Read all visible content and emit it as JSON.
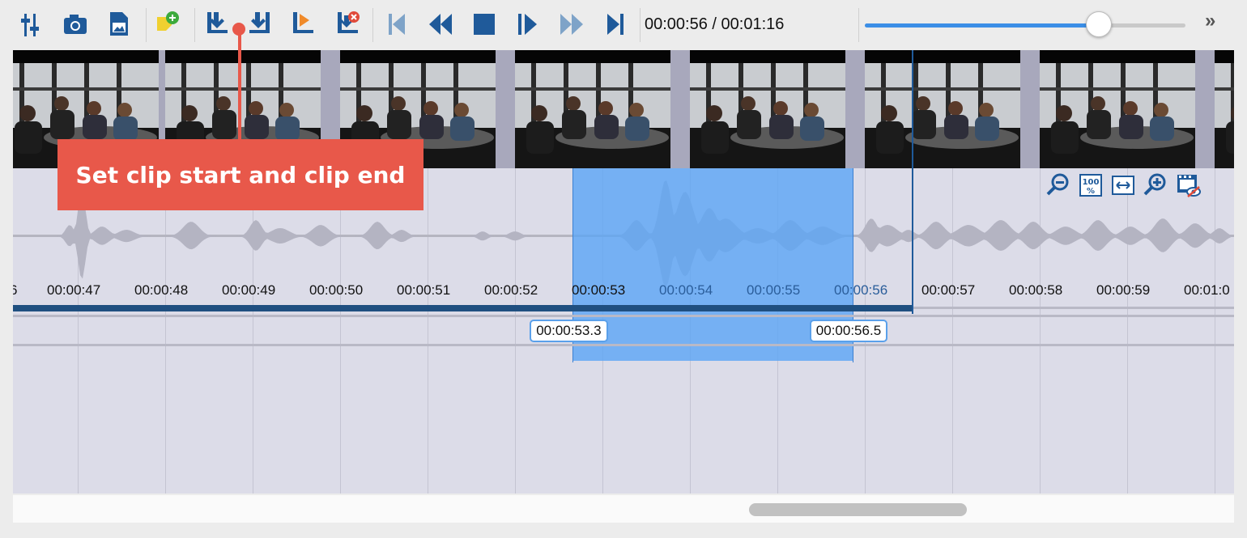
{
  "toolbar": {
    "buttons": [
      {
        "name": "adjust-icon",
        "color": "#1f5a9a"
      },
      {
        "name": "camera-icon",
        "color": "#1f5a9a"
      },
      {
        "name": "image-export-icon",
        "color": "#1f5a9a"
      },
      {
        "name": "add-note-icon",
        "color": "#f0d030"
      },
      {
        "name": "set-clip-start-icon",
        "color": "#1f5a9a"
      },
      {
        "name": "set-clip-end-icon",
        "color": "#1f5a9a"
      },
      {
        "name": "play-clip-icon",
        "color": "#f08a2a"
      },
      {
        "name": "delete-clip-icon",
        "color": "#e04a3a"
      },
      {
        "name": "go-to-start-icon",
        "color": "#7ea3c8"
      },
      {
        "name": "rewind-icon",
        "color": "#1f5a9a"
      },
      {
        "name": "stop-icon",
        "color": "#1f5a9a"
      },
      {
        "name": "play-frame-icon",
        "color": "#1f5a9a"
      },
      {
        "name": "fast-forward-icon",
        "color": "#7ea3c8"
      },
      {
        "name": "go-to-end-icon",
        "color": "#1f5a9a"
      }
    ],
    "timecode": "00:00:56 / 00:01:16",
    "volume_fraction": 0.73,
    "more_label": "»"
  },
  "callout": {
    "text": "Set clip start and clip end"
  },
  "timeline": {
    "ticks": [
      {
        "label": "6",
        "insel": false
      },
      {
        "label": "00:00:47",
        "insel": false
      },
      {
        "label": "00:00:48",
        "insel": false
      },
      {
        "label": "00:00:49",
        "insel": false
      },
      {
        "label": "00:00:50",
        "insel": false
      },
      {
        "label": "00:00:51",
        "insel": false
      },
      {
        "label": "00:00:52",
        "insel": false
      },
      {
        "label": "00:00:53",
        "insel": false
      },
      {
        "label": "00:00:54",
        "insel": true
      },
      {
        "label": "00:00:55",
        "insel": true
      },
      {
        "label": "00:00:56",
        "insel": true
      },
      {
        "label": "00:00:57",
        "insel": false
      },
      {
        "label": "00:00:58",
        "insel": false
      },
      {
        "label": "00:00:59",
        "insel": false
      },
      {
        "label": "00:01:0",
        "insel": false
      }
    ],
    "clip_start": "00:00:53.3",
    "clip_end": "00:00:56.5",
    "zoom_buttons": [
      "zoom-out-icon",
      "zoom-100-icon",
      "fit-width-icon",
      "zoom-in-icon",
      "toggle-thumbnails-icon"
    ],
    "zoom_100_label": "100 %",
    "selection_color": "#58a4f6"
  }
}
